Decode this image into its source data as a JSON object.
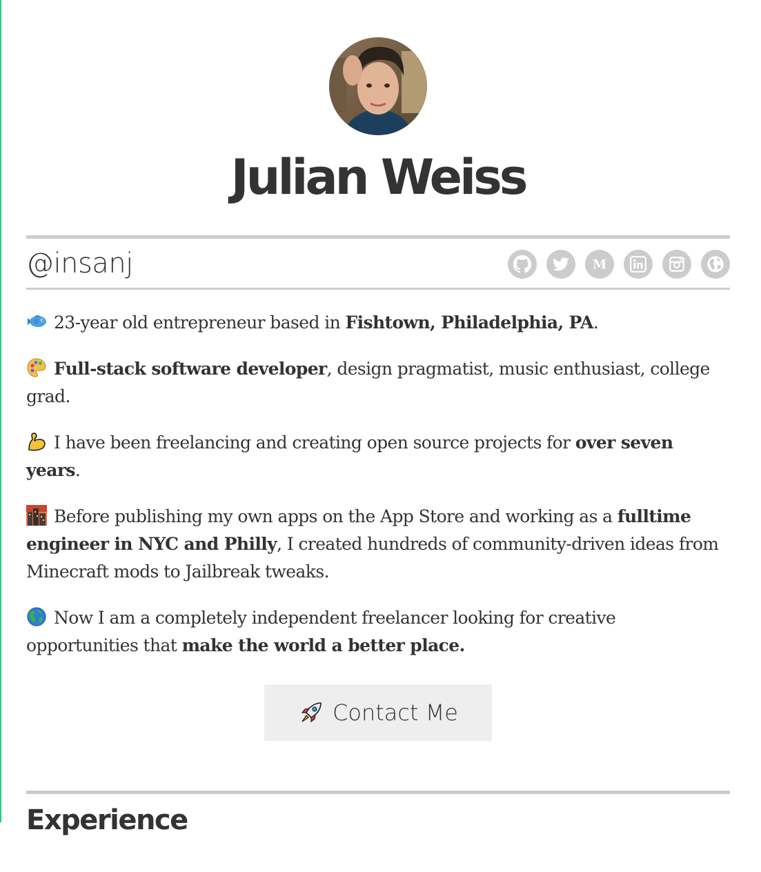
{
  "profile": {
    "name": "Julian Weiss",
    "handle": "@insanj"
  },
  "social": [
    {
      "icon": "github-icon",
      "label": "GitHub"
    },
    {
      "icon": "twitter-icon",
      "label": "Twitter"
    },
    {
      "icon": "medium-icon",
      "label": "Medium"
    },
    {
      "icon": "linkedin-icon",
      "label": "LinkedIn"
    },
    {
      "icon": "instagram-icon",
      "label": "Instagram"
    },
    {
      "icon": "globe-icon",
      "label": "Website"
    }
  ],
  "bio": {
    "p1": {
      "icon": "fish-icon",
      "before": "23-year old entrepreneur based in ",
      "bold": "Fishtown, Philadelphia, PA",
      "after": "."
    },
    "p2": {
      "icon": "palette-icon",
      "bold": "Full-stack software developer",
      "after": ", design pragmatist, music enthusiast, college grad."
    },
    "p3": {
      "icon": "flexed-biceps-icon",
      "before": "I have been freelancing and creating open source projects for ",
      "bold": "over seven years",
      "after": "."
    },
    "p4": {
      "icon": "city-dusk-icon",
      "before": "Before publishing my own apps on the App Store and working as a ",
      "bold": "fulltime engineer in NYC and Philly",
      "after": ", I created hundreds of community-driven ideas from Minecraft mods to Jailbreak tweaks."
    },
    "p5": {
      "icon": "globe-americas-icon",
      "before": "Now I am a completely independent freelancer looking for creative opportunities that ",
      "bold": "make the world a better place."
    }
  },
  "contact": {
    "icon": "rocket-icon",
    "label": "Contact Me"
  },
  "sections": {
    "experience_title": "Experience"
  },
  "colors": {
    "text": "#333333",
    "rule": "#cccccc",
    "icon_bg": "#cccccc",
    "button_bg": "#eeeeee",
    "accent_green": "#2ecc71"
  }
}
